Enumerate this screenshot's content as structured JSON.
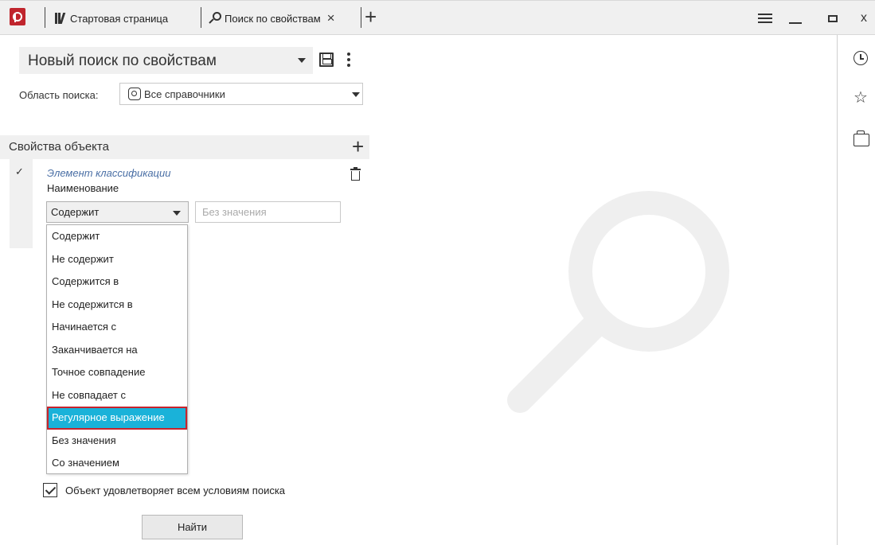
{
  "titlebar": {
    "tabs": [
      {
        "label": "Стартовая страница",
        "icon": "library-icon"
      },
      {
        "label": "Поиск по свойствам",
        "icon": "search-icon",
        "close": "×"
      }
    ],
    "add_tab": "+",
    "close_window": "x"
  },
  "left": {
    "search_name": "Новый поиск по свойствам",
    "area_label": "Область поиска:",
    "area_value": "Все справочники",
    "properties_header": "Свойства объекта",
    "add_property": "+",
    "condition": {
      "check": "✓",
      "class_label": "Элемент классификации",
      "property_name": "Наименование",
      "operator": "Содержит",
      "value_placeholder": "Без значения"
    },
    "dropdown_options": [
      "Содержит",
      "Не содержит",
      "Содержится в",
      "Не содержится в",
      "Начинается с",
      "Заканчивается на",
      "Точное совпадение",
      "Не совпадает с",
      "Регулярное выражение",
      "Без значения",
      "Со значением"
    ],
    "selected_option": "Регулярное выражение",
    "match_all_label": "Объект удовлетворяет всем условиям поиска",
    "match_all_checked": true,
    "find_button": "Найти"
  },
  "rail": {
    "icons": [
      "history-clock-icon",
      "favorites-star-icon",
      "folders-icon"
    ],
    "star_glyph": "☆"
  },
  "colors": {
    "accent_brand": "#c0252d",
    "selection": "#1ab2d9",
    "highlight_border": "#c8232c",
    "link": "#4a6fa5"
  }
}
